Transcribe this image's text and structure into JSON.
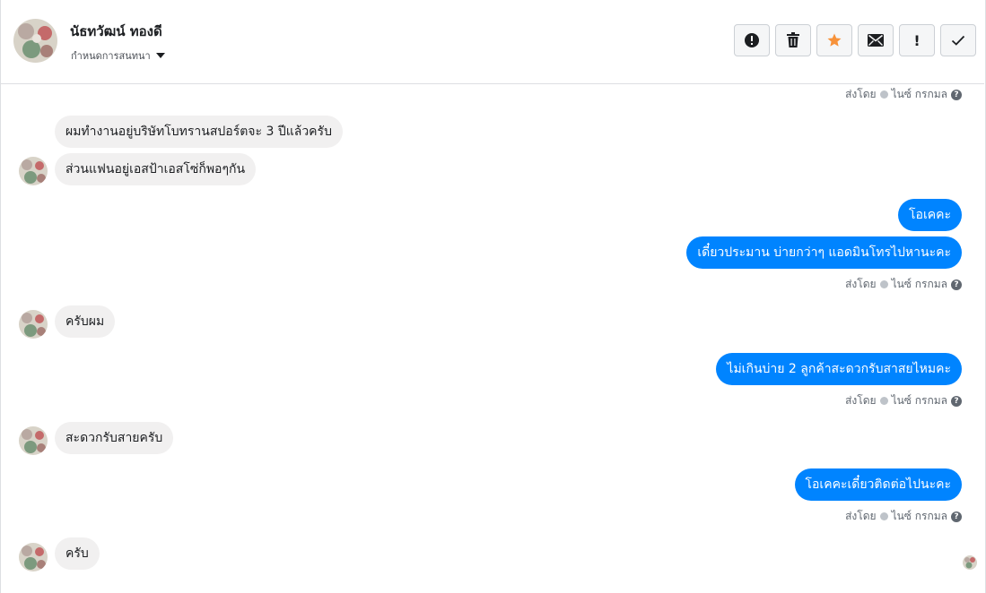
{
  "header": {
    "contact_name": "นัธทวัฒน์ ทองดี",
    "assign_label": "กำหนดการสนทนา",
    "actions": [
      {
        "icon": "alert-circle-icon"
      },
      {
        "icon": "trash-icon"
      },
      {
        "icon": "star-icon",
        "color": "#f7923a"
      },
      {
        "icon": "envelope-icon"
      },
      {
        "icon": "exclamation-icon",
        "label": "!"
      },
      {
        "icon": "check-icon"
      }
    ]
  },
  "meta_text": {
    "sent_by": "ส่งโดย",
    "sender": "ไนซ์ กรกมล",
    "help": "?"
  },
  "messages": [
    {
      "dir": "in",
      "text": "ผมทำงานอยู่บริษัทโบทรานสปอร์ตจะ 3 ปีแล้วครับ"
    },
    {
      "dir": "in",
      "text": "ส่วนแฟนอยู่เอสป้าเอสโซ่ก็พอๆกัน"
    },
    {
      "dir": "out",
      "text": "โอเคคะ"
    },
    {
      "dir": "out",
      "text": "เดี๋ยวประมาน บ่ายกว่าๆ แอดมินโทรไปหานะคะ"
    },
    {
      "dir": "in",
      "text": "ครับผม"
    },
    {
      "dir": "out",
      "text": "ไม่เกินบ่าย 2 ลูกค้าสะดวกรับสาสยไหมคะ"
    },
    {
      "dir": "in",
      "text": "สะดวกรับสายครับ"
    },
    {
      "dir": "out",
      "text": "โอเคคะเดี๋ยวติดต่อไปนะคะ"
    },
    {
      "dir": "in",
      "text": "ครับ"
    }
  ],
  "colors": {
    "outgoing": "#0084ff",
    "incoming": "#f1f0f0"
  }
}
